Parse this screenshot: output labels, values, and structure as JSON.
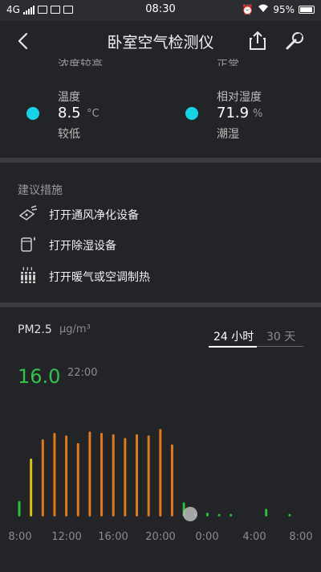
{
  "status_bar": {
    "network": "4G",
    "time": "08:30",
    "battery_percent": "95%"
  },
  "header": {
    "title": "卧室空气检测仪",
    "icons": [
      "back-icon",
      "share-icon",
      "wrench-icon"
    ]
  },
  "top_metrics": {
    "cut_left_label": "浓度较高",
    "cut_right_label": "正常",
    "temperature": {
      "label": "温度",
      "value": "8.5",
      "unit": "°C",
      "status": "较低"
    },
    "humidity": {
      "label": "相对湿度",
      "value": "71.9",
      "unit": "%",
      "status": "潮湿"
    },
    "indicator_color": "#18d3e8"
  },
  "advice": {
    "title": "建议措施",
    "items": [
      {
        "icon": "ventilation-icon",
        "label": "打开通风净化设备"
      },
      {
        "icon": "dehumidifier-icon",
        "label": "打开除湿设备"
      },
      {
        "icon": "heater-icon",
        "label": "打开暖气或空调制热"
      }
    ]
  },
  "pm": {
    "label": "PM2.5",
    "unit": "μg/m³",
    "current_value": "16.0",
    "current_time": "22:00",
    "tabs": [
      "24 小时",
      "30 天"
    ],
    "active_tab": "24 小时"
  },
  "chart_data": {
    "type": "bar",
    "xlabels": [
      "8:00",
      "12:00",
      "16:00",
      "20:00",
      "0:00",
      "4:00",
      "8:00"
    ],
    "colors": {
      "good": "#2bbf3a",
      "moderate": "#d8c21c",
      "high": "#e07a1f"
    },
    "bars": [
      {
        "value": 12,
        "level": "good"
      },
      {
        "value": 45,
        "level": "moderate"
      },
      {
        "value": 60,
        "level": "high"
      },
      {
        "value": 65,
        "level": "high"
      },
      {
        "value": 63,
        "level": "high"
      },
      {
        "value": 57,
        "level": "high"
      },
      {
        "value": 66,
        "level": "high"
      },
      {
        "value": 65,
        "level": "high"
      },
      {
        "value": 64,
        "level": "high"
      },
      {
        "value": 61,
        "level": "high"
      },
      {
        "value": 64,
        "level": "high"
      },
      {
        "value": 63,
        "level": "high"
      },
      {
        "value": 68,
        "level": "high"
      },
      {
        "value": 56,
        "level": "high"
      },
      {
        "value": 11,
        "level": "good"
      },
      {
        "value": 2,
        "level": "good"
      },
      {
        "value": 3,
        "level": "good"
      },
      {
        "value": 2,
        "level": "good"
      },
      {
        "value": 2,
        "level": "good"
      },
      {
        "value": 0,
        "level": "none"
      },
      {
        "value": 0,
        "level": "none"
      },
      {
        "value": 6,
        "level": "good"
      },
      {
        "value": 0,
        "level": "none"
      },
      {
        "value": 2,
        "level": "good"
      }
    ],
    "ymax": 75
  }
}
